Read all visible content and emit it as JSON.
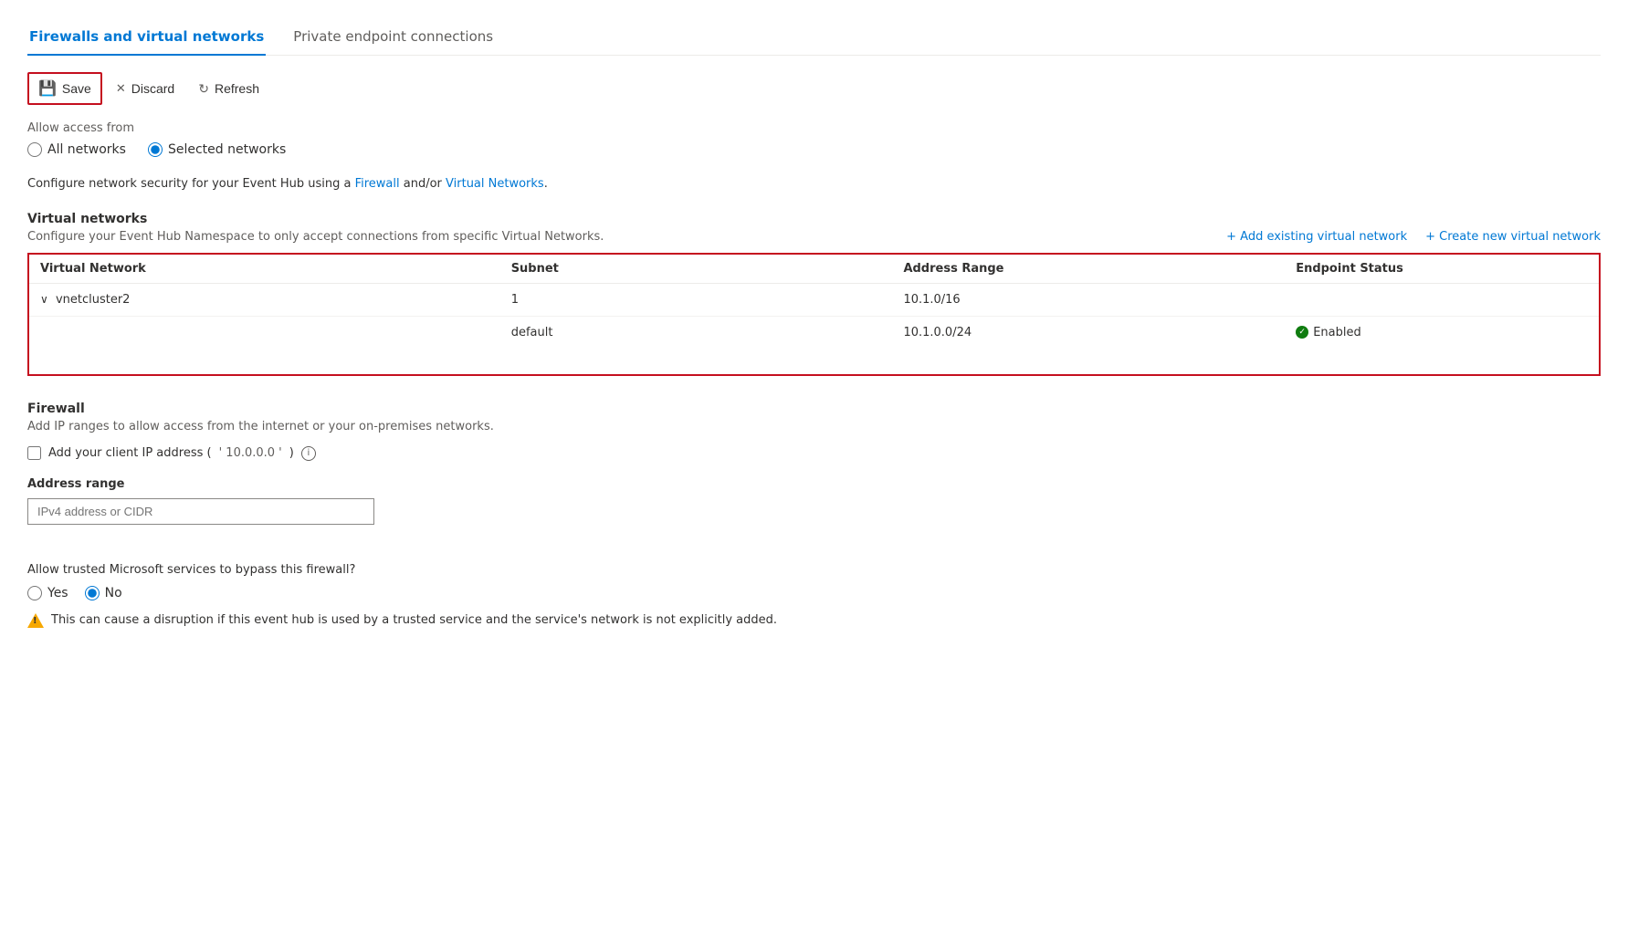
{
  "tabs": [
    {
      "id": "firewalls",
      "label": "Firewalls and virtual networks",
      "active": true
    },
    {
      "id": "private",
      "label": "Private endpoint connections",
      "active": false
    }
  ],
  "toolbar": {
    "save_label": "Save",
    "discard_label": "Discard",
    "refresh_label": "Refresh"
  },
  "access": {
    "allow_label": "Allow access from",
    "all_networks_label": "All networks",
    "selected_networks_label": "Selected networks",
    "selected": "selected"
  },
  "description": {
    "prefix": "Configure network security for your Event Hub using a ",
    "firewall_link": "Firewall",
    "middle": " and/or ",
    "vnet_link": "Virtual Networks",
    "suffix": "."
  },
  "virtual_networks": {
    "title": "Virtual networks",
    "subtitle": "Configure your Event Hub Namespace to only accept connections from specific Virtual Networks.",
    "add_existing_link": "+ Add existing virtual network",
    "create_new_link": "+ Create new virtual network",
    "table": {
      "columns": [
        "Virtual Network",
        "Subnet",
        "Address Range",
        "Endpoint Status"
      ],
      "rows": [
        {
          "vnet": "vnetcluster2",
          "subnet": "1",
          "address_range": "10.1.0/16",
          "status": "",
          "expanded": true
        },
        {
          "vnet": "",
          "subnet": "default",
          "address_range": "10.1.0.0/24",
          "status": "Enabled",
          "expanded": false
        }
      ]
    }
  },
  "firewall": {
    "title": "Firewall",
    "description": "Add IP ranges to allow access from the internet or your on-premises networks.",
    "checkbox_label": "Add your client IP address (",
    "client_ip": "' 10.0.0.0  '",
    "checkbox_suffix": ")",
    "address_range_label": "Address range",
    "address_placeholder": "IPv4 address or CIDR"
  },
  "trusted_services": {
    "question": "Allow trusted Microsoft services to bypass this firewall?",
    "yes_label": "Yes",
    "no_label": "No",
    "selected": "no",
    "warning": "This can cause a disruption if this event hub is used by a trusted service and the service's network is not explicitly added."
  }
}
